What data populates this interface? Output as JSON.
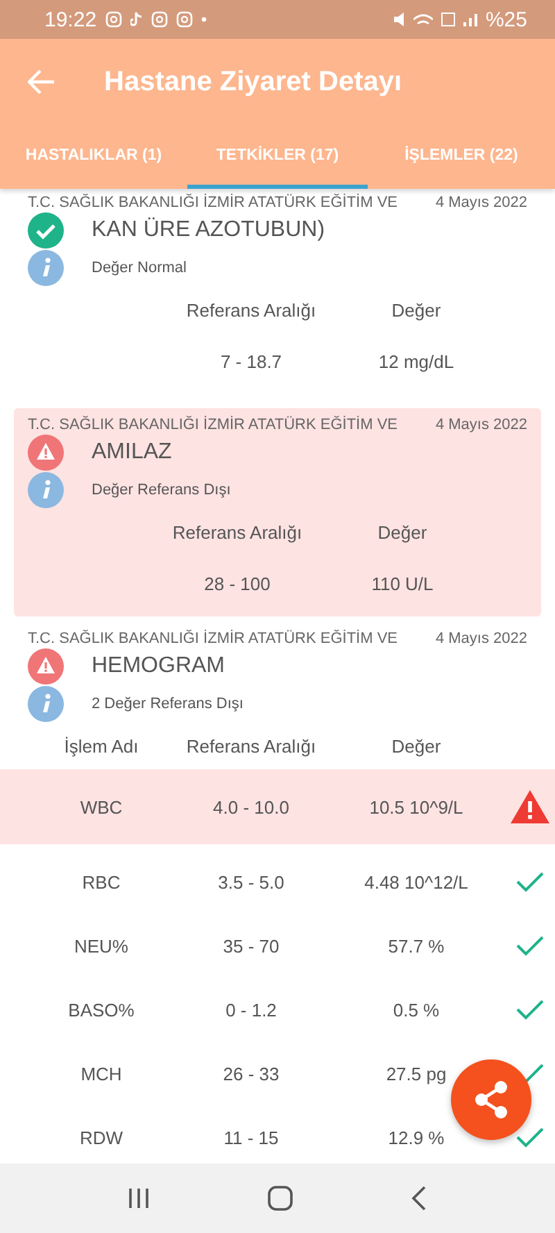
{
  "status_bar": {
    "time": "19:22",
    "battery": "%25"
  },
  "app_bar": {
    "title": "Hastane Ziyaret Detayı"
  },
  "tabs": [
    {
      "label": "HASTALIKLAR (1)",
      "selected": false
    },
    {
      "label": "TETKİKLER (17)",
      "selected": true
    },
    {
      "label": "İŞLEMLER (22)",
      "selected": false
    }
  ],
  "results": [
    {
      "kind": "single",
      "institution": "T.C. SAĞLIK BAKANLIĞI İZMİR ATATÜRK EĞİTİM VE",
      "date": "4 Mayıs 2022",
      "test": "KAN ÜRE AZOTUBUN)",
      "out_of_range": false,
      "highlighted": false,
      "note": "Değer Normal",
      "columns": [
        "Referans Aralığı",
        "Değer"
      ],
      "reference": "7 - 18.7",
      "value": "12 mg/dL"
    },
    {
      "kind": "single",
      "institution": "T.C. SAĞLIK BAKANLIĞI İZMİR ATATÜRK EĞİTİM VE",
      "date": "4 Mayıs 2022",
      "test": "AMILAZ",
      "out_of_range": true,
      "highlighted": true,
      "note": "Değer Referans Dışı",
      "columns": [
        "Referans Aralığı",
        "Değer"
      ],
      "reference": "28 - 100",
      "value": "110 U/L"
    },
    {
      "kind": "panel",
      "institution": "T.C. SAĞLIK BAKANLIĞI İZMİR ATATÜRK EĞİTİM VE",
      "date": "4 Mayıs 2022",
      "test": "HEMOGRAM",
      "out_of_range": true,
      "highlighted": false,
      "note": "2 Değer Referans Dışı",
      "columns": [
        "İşlem Adı",
        "Referans Aralığı",
        "Değer"
      ],
      "rows": [
        {
          "name": "WBC",
          "reference": "4.0 - 10.0",
          "value": "10.5 10^9/L",
          "out_of_range": true
        },
        {
          "name": "RBC",
          "reference": "3.5 - 5.0",
          "value": "4.48 10^12/L",
          "out_of_range": false
        },
        {
          "name": "NEU%",
          "reference": "35 - 70",
          "value": "57.7 %",
          "out_of_range": false
        },
        {
          "name": "BASO%",
          "reference": "0 - 1.2",
          "value": "0.5 %",
          "out_of_range": false
        },
        {
          "name": "MCH",
          "reference": "26 - 33",
          "value": "27.5 pg",
          "out_of_range": false
        },
        {
          "name": "RDW",
          "reference": "11 - 15",
          "value": "12.9 %",
          "out_of_range": false
        }
      ]
    }
  ]
}
